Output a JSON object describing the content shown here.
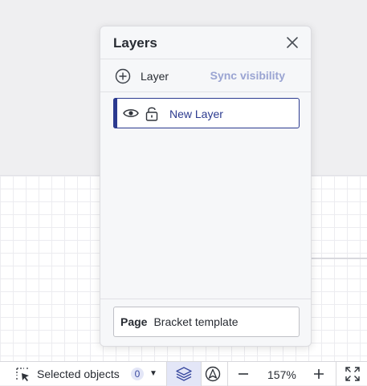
{
  "layers_panel": {
    "title": "Layers",
    "add_layer_label": "Layer",
    "sync_visibility_label": "Sync visibility",
    "layers": [
      {
        "name": "New Layer",
        "visible": true,
        "locked": false,
        "selected": true
      }
    ],
    "page": {
      "label": "Page",
      "value": "Bracket template"
    }
  },
  "toolbar": {
    "selected_objects_label": "Selected objects",
    "selected_count": "0",
    "zoom_level": "157%"
  },
  "colors": {
    "accent": "#2b3a8f",
    "sync_text": "#9aa4d2",
    "toolbar_active_bg": "#e3e6f7"
  },
  "icons": {
    "close": "close-icon",
    "add": "plus-circle-icon",
    "eye": "eye-icon",
    "lock": "unlocked-icon",
    "select": "select-cursor-icon",
    "layers": "layers-icon",
    "navigate": "navigation-icon",
    "zoom_out": "minus-icon",
    "zoom_in": "plus-icon",
    "fullscreen": "fullscreen-icon"
  }
}
